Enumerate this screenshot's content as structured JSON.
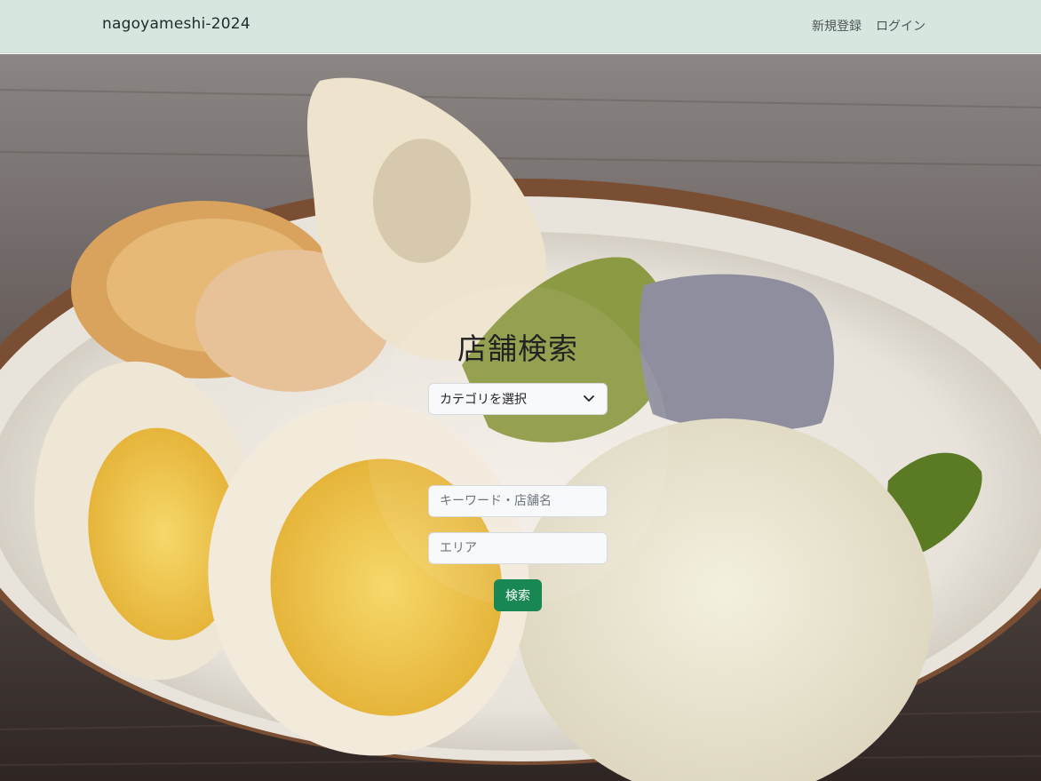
{
  "navbar": {
    "brand": "nagoyameshi-2024",
    "links": [
      "新規登録",
      "ログイン"
    ]
  },
  "search": {
    "title": "店舗検索",
    "category_select": "カテゴリを選択",
    "keyword_placeholder": "キーワード・店舗名",
    "area_placeholder": "エリア",
    "button_label": "検索"
  },
  "colors": {
    "navbar_bg": "#d8e6e0",
    "button_bg": "#198754"
  },
  "icons": {
    "select_arrow": "chevron-down-icon"
  }
}
